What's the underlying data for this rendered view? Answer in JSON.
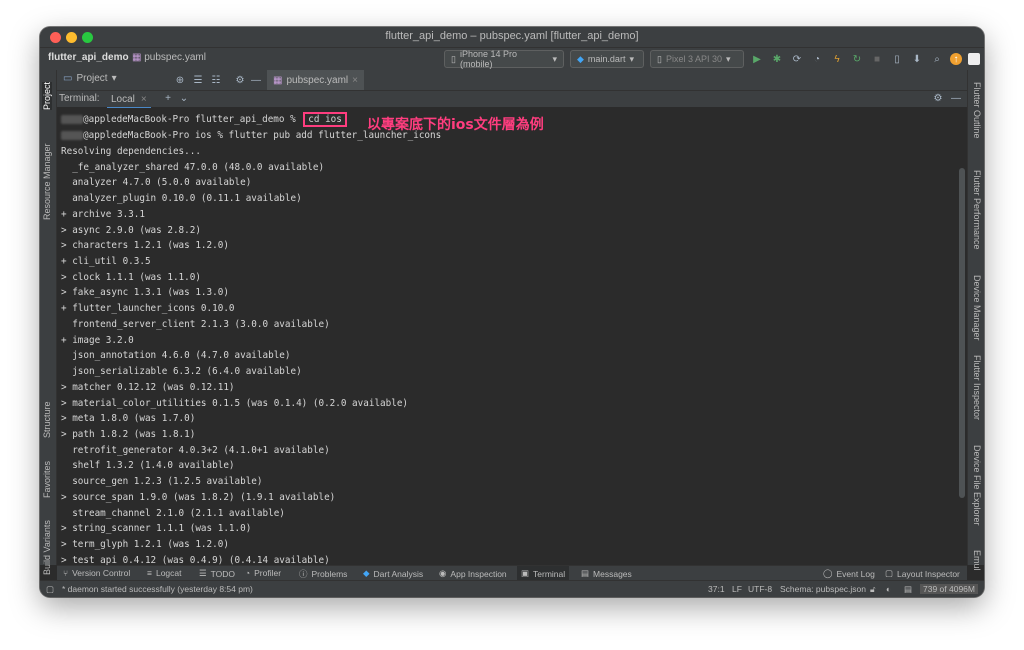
{
  "window": {
    "title": "flutter_api_demo – pubspec.yaml [flutter_api_demo]"
  },
  "navbar": {
    "project": "flutter_api_demo",
    "file": "pubspec.yaml",
    "device": "iPhone 14 Pro (mobile)",
    "run_config": "main.dart",
    "emulator": "Pixel 3 API 30"
  },
  "left_strip": {
    "project": "Project",
    "resource_manager": "Resource Manager",
    "structure": "Structure",
    "favorites": "Favorites",
    "build_variants": "Build Variants"
  },
  "right_strip": {
    "flutter_outline": "Flutter Outline",
    "flutter_performance": "Flutter Performance",
    "device_manager": "Device Manager",
    "flutter_inspector": "Flutter Inspector",
    "device_file_explorer": "Device File Explorer",
    "emul": "Emul"
  },
  "editor": {
    "project_label": "Project",
    "tab": "pubspec.yaml"
  },
  "terminal": {
    "label": "Terminal:",
    "tab": "Local",
    "annotation": "以專案底下的ios文件層為例",
    "prompt1": "@appledeMacBook-Pro flutter_api_demo % ",
    "cmd1": "cd ios",
    "prompt2": "@appledeMacBook-Pro ios % flutter pub add flutter_launcher_icons",
    "lines": [
      "Resolving dependencies...",
      "  _fe_analyzer_shared 47.0.0 (48.0.0 available)",
      "  analyzer 4.7.0 (5.0.0 available)",
      "  analyzer_plugin 0.10.0 (0.11.1 available)",
      "+ archive 3.3.1",
      "> async 2.9.0 (was 2.8.2)",
      "> characters 1.2.1 (was 1.2.0)",
      "+ cli_util 0.3.5",
      "> clock 1.1.1 (was 1.1.0)",
      "> fake_async 1.3.1 (was 1.3.0)",
      "+ flutter_launcher_icons 0.10.0",
      "  frontend_server_client 2.1.3 (3.0.0 available)",
      "+ image 3.2.0",
      "  json_annotation 4.6.0 (4.7.0 available)",
      "  json_serializable 6.3.2 (6.4.0 available)",
      "> matcher 0.12.12 (was 0.12.11)",
      "> material_color_utilities 0.1.5 (was 0.1.4) (0.2.0 available)",
      "> meta 1.8.0 (was 1.7.0)",
      "> path 1.8.2 (was 1.8.1)",
      "  retrofit_generator 4.0.3+2 (4.1.0+1 available)",
      "  shelf 1.3.2 (1.4.0 available)",
      "  source_gen 1.2.3 (1.2.5 available)",
      "> source_span 1.9.0 (was 1.8.2) (1.9.1 available)",
      "  stream_channel 2.1.0 (2.1.1 available)",
      "> string_scanner 1.1.1 (was 1.1.0)",
      "> term_glyph 1.2.1 (was 1.2.0)",
      "> test_api 0.4.12 (was 0.4.9) (0.4.14 available)"
    ]
  },
  "bottom_tabs": {
    "version_control": "Version Control",
    "logcat": "Logcat",
    "todo": "TODO",
    "profiler": "Profiler",
    "problems": "Problems",
    "dart_analysis": "Dart Analysis",
    "app_inspection": "App Inspection",
    "terminal": "Terminal",
    "messages": "Messages",
    "event_log": "Event Log",
    "layout_inspector": "Layout Inspector"
  },
  "statusbar": {
    "message": "* daemon started successfully (yesterday 8:54 pm)",
    "position": "37:1",
    "line_sep": "LF",
    "encoding": "UTF-8",
    "schema": "Schema: pubspec.json",
    "memory": "739 of 4096M"
  },
  "colors": {
    "accent": "#ff3d7f",
    "bg": "#2b2b2b",
    "chrome": "#3c3f41"
  }
}
